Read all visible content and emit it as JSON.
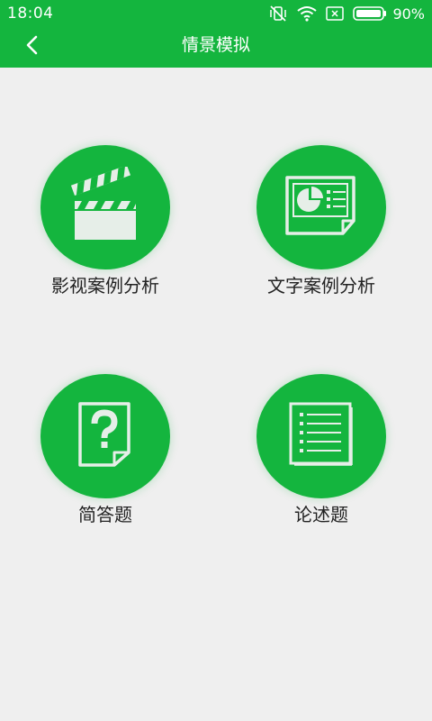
{
  "status_bar": {
    "time": "18:04",
    "battery_text": "90%",
    "icons": [
      "vibrate-off-icon",
      "wifi-icon",
      "no-sim-icon",
      "battery-icon"
    ]
  },
  "header": {
    "title": "情景模拟",
    "back_icon": "chevron-left-icon",
    "background_color": "#14b53e"
  },
  "menu": {
    "items": [
      {
        "label": "影视案例分析",
        "icon": "clapperboard-icon"
      },
      {
        "label": "文字案例分析",
        "icon": "document-chart-icon"
      },
      {
        "label": "简答题",
        "icon": "question-document-icon"
      },
      {
        "label": "论述题",
        "icon": "list-document-icon"
      }
    ]
  },
  "colors": {
    "accent": "#14b53e",
    "background": "#efefef",
    "icon_fill": "#e6eee8"
  }
}
